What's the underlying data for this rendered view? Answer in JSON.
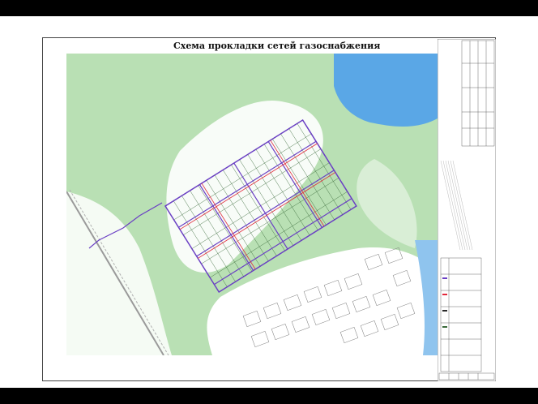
{
  "slide": {
    "title": "Схема прокладки сетей газоснабжения"
  },
  "colors": {
    "background": "#ffffff",
    "frame": "#000000",
    "vegetation": "#b9e0b4",
    "open_land": "#ffffff",
    "water": "#5aa7e6",
    "gas_pipeline": "#6a3fc4",
    "pipeline_red": "#e2283b",
    "parcel_lines": "#3b6a3b"
  },
  "map": {
    "features": [
      "water-body",
      "forest-area",
      "settlement-grid",
      "gas-network",
      "highway",
      "legend",
      "title-block"
    ]
  }
}
